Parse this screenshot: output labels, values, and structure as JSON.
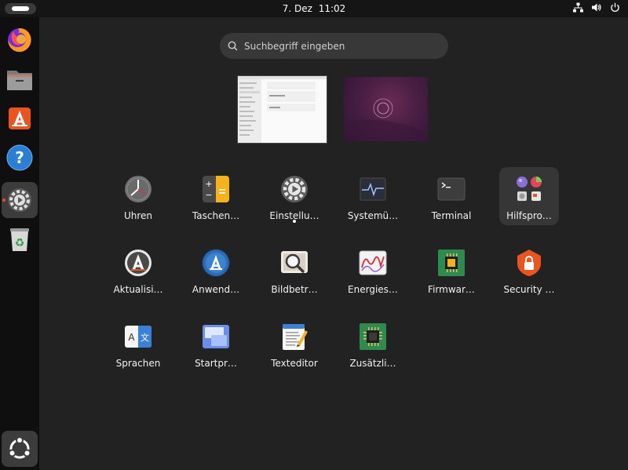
{
  "topbar": {
    "date": "7. Dez",
    "time": "11:02"
  },
  "search": {
    "placeholder": "Suchbegriff eingeben"
  },
  "dock": {
    "items": [
      "firefox-icon",
      "files-icon",
      "app-center-icon",
      "help-icon",
      "settings-icon",
      "trash-icon",
      "show-apps-icon"
    ]
  },
  "apps": {
    "row1": [
      "Uhren",
      "Taschen…",
      "Einstellu…",
      "Systemü…",
      "Terminal",
      "Hilfspro…"
    ],
    "row2": [
      "Aktualisi…",
      "Anwend…",
      "Bildbetr…",
      "Energies…",
      "Firmwar…",
      "Security …"
    ],
    "row3": [
      "Sprachen",
      "Startpr…",
      "Texteditor",
      "Zusätzli…"
    ]
  },
  "colors": {
    "accent": "#e95420",
    "background": "#222222",
    "dock": "#0f0f0f"
  }
}
